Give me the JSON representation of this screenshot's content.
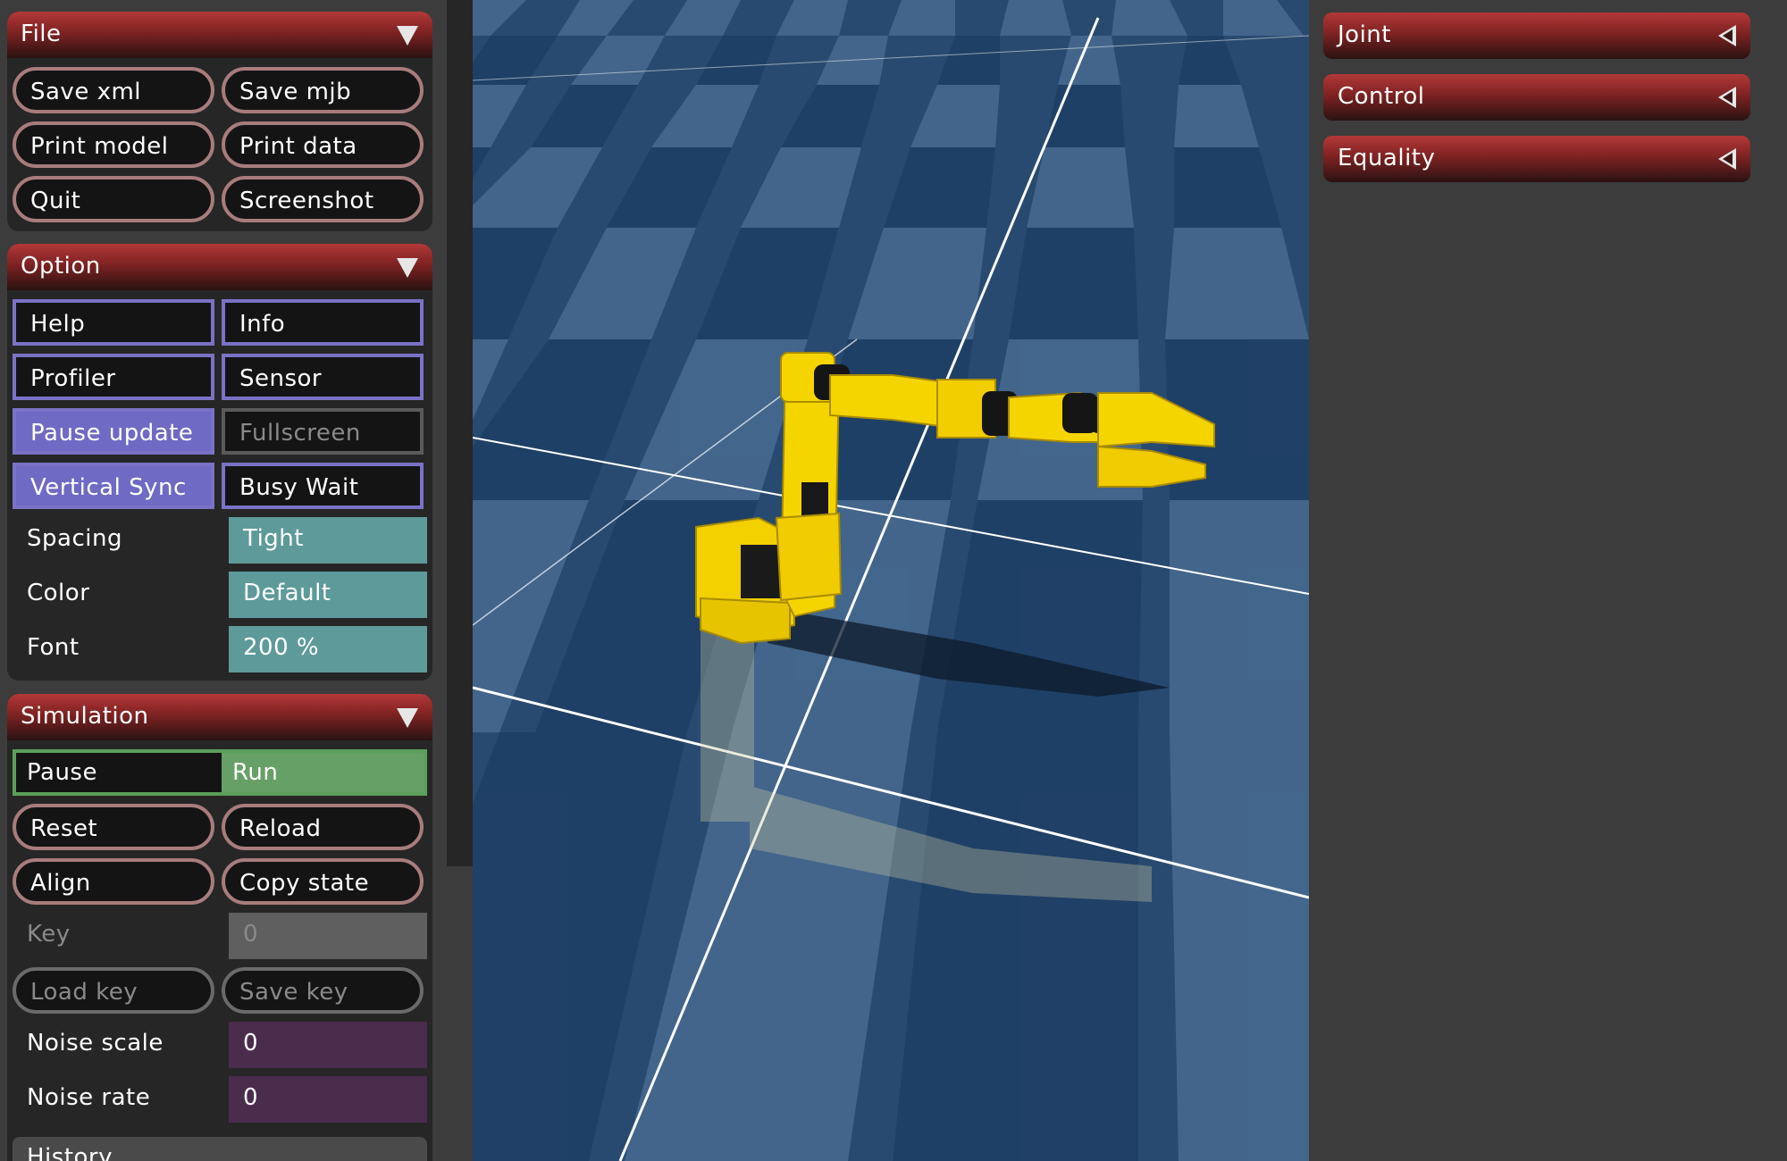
{
  "file": {
    "title": "File",
    "save_xml": "Save xml",
    "save_mjb": "Save mjb",
    "print_model": "Print model",
    "print_data": "Print data",
    "quit": "Quit",
    "screenshot": "Screenshot"
  },
  "option": {
    "title": "Option",
    "help": "Help",
    "info": "Info",
    "profiler": "Profiler",
    "sensor": "Sensor",
    "pause_update": "Pause update",
    "fullscreen": "Fullscreen",
    "vertical_sync": "Vertical Sync",
    "busy_wait": "Busy Wait",
    "spacing_label": "Spacing",
    "spacing_value": "Tight",
    "color_label": "Color",
    "color_value": "Default",
    "font_label": "Font",
    "font_value": "200 %"
  },
  "simulation": {
    "title": "Simulation",
    "pause": "Pause",
    "run": "Run",
    "reset": "Reset",
    "reload": "Reload",
    "align": "Align",
    "copy_state": "Copy state",
    "key_label": "Key",
    "key_value": "0",
    "load_key": "Load key",
    "save_key": "Save key",
    "noise_scale_label": "Noise scale",
    "noise_scale_value": "0",
    "noise_rate_label": "Noise rate",
    "noise_rate_value": "0"
  },
  "history": {
    "title": "History"
  },
  "right_panel": {
    "joint": "Joint",
    "control": "Control",
    "equality": "Equality"
  },
  "colors": {
    "header_red": "#b33838",
    "checkbox_blue": "#6f6ac4",
    "select_teal": "#5f9a9a",
    "radio_green": "#67a067",
    "edit_purple": "#4a2c4d",
    "floor_dark": "#1f3f66",
    "floor_light": "#43668e",
    "robot_yellow": "#f5d500"
  }
}
